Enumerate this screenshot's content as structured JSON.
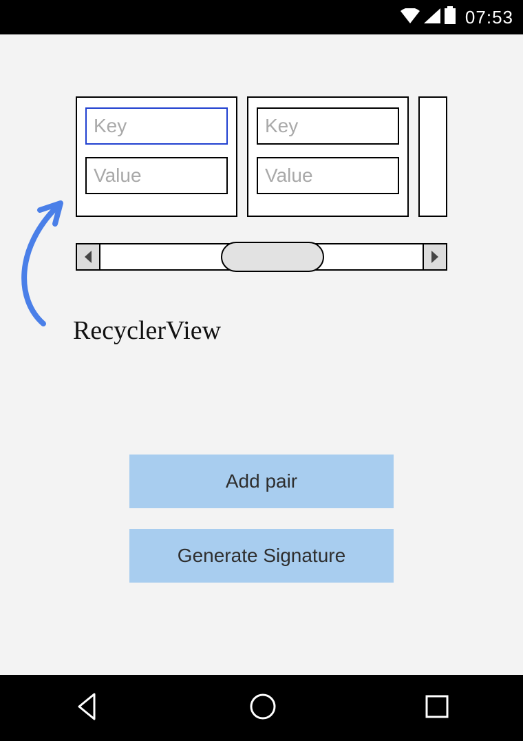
{
  "status": {
    "clock": "07:53"
  },
  "recycler": {
    "label": "RecyclerView",
    "cards": [
      {
        "key_placeholder": "Key",
        "value_placeholder": "Value",
        "key_value": "",
        "value_value": ""
      },
      {
        "key_placeholder": "Key",
        "value_placeholder": "Value",
        "key_value": "",
        "value_value": ""
      }
    ]
  },
  "buttons": {
    "add_pair": "Add pair",
    "generate_signature": "Generate Signature"
  }
}
